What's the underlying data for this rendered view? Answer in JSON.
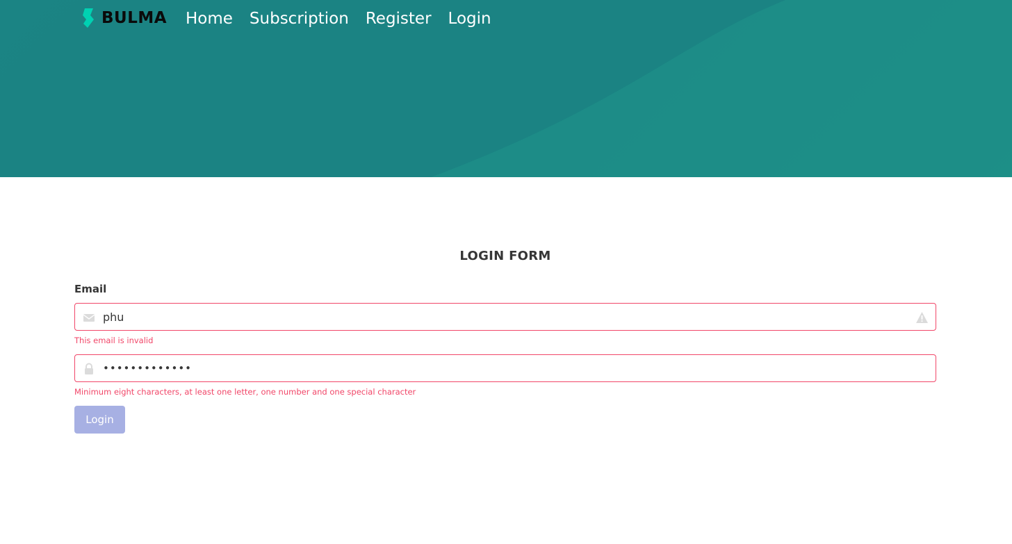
{
  "colors": {
    "hero_bg": "#1f8a8a",
    "brand_mark": "#00d1b2",
    "danger": "#f14668",
    "button_bg": "#a7b0e3"
  },
  "navbar": {
    "brand": {
      "text": "BULMA",
      "logo_icon": "bulma-logo-icon"
    },
    "links": [
      {
        "label": "Home"
      },
      {
        "label": "Subscription"
      },
      {
        "label": "Register"
      },
      {
        "label": "Login"
      }
    ]
  },
  "form": {
    "title": "LOGIN FORM",
    "email": {
      "label": "Email",
      "value": "phu",
      "left_icon": "envelope-icon",
      "right_icon": "warning-icon",
      "help": "This email is invalid"
    },
    "password": {
      "value": "•••••••••••••",
      "left_icon": "lock-icon",
      "help": "Minimum eight characters, at least one letter, one number and one special character"
    },
    "submit_label": "Login"
  }
}
